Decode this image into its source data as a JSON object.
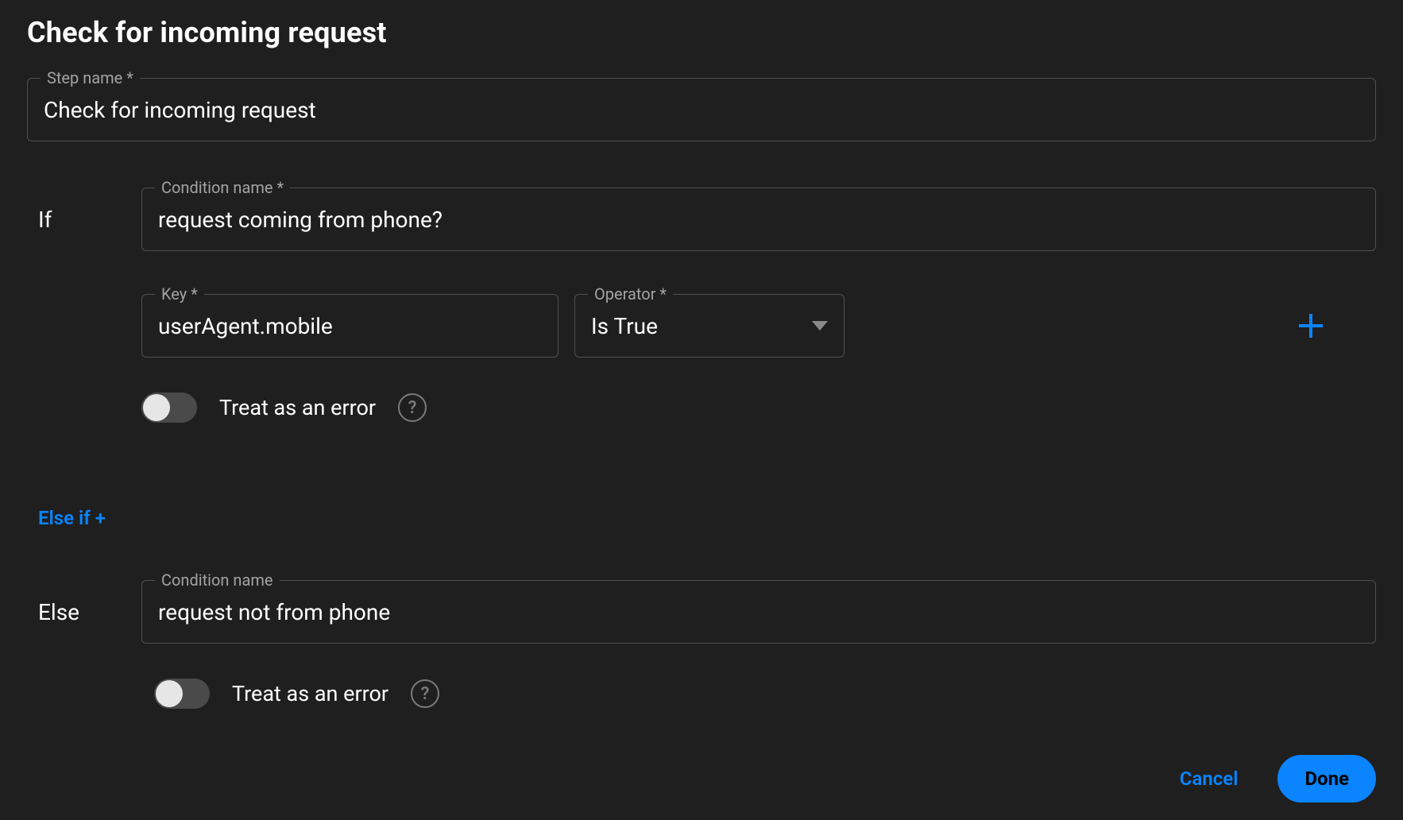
{
  "panel": {
    "title": "Check for incoming request"
  },
  "stepName": {
    "label": "Step name *",
    "value": "Check for incoming request"
  },
  "ifBranch": {
    "label": "If",
    "conditionName": {
      "label": "Condition name *",
      "value": "request coming from phone?"
    },
    "key": {
      "label": "Key *",
      "value": "userAgent.mobile"
    },
    "operator": {
      "label": "Operator *",
      "value": "Is True"
    },
    "treatAsErrorLabel": "Treat as an error",
    "treatAsError": false
  },
  "elseIfLink": "Else if +",
  "elseBranch": {
    "label": "Else",
    "conditionName": {
      "label": "Condition name",
      "value": "request not from phone"
    },
    "treatAsErrorLabel": "Treat as an error",
    "treatAsError": false
  },
  "buttons": {
    "cancel": "Cancel",
    "done": "Done"
  },
  "icons": {
    "add": "plus-icon",
    "help": "question-icon",
    "caret": "chevron-down-icon"
  },
  "colors": {
    "accent": "#0a84ff",
    "border": "#505050",
    "bg": "#1f1f1f"
  }
}
